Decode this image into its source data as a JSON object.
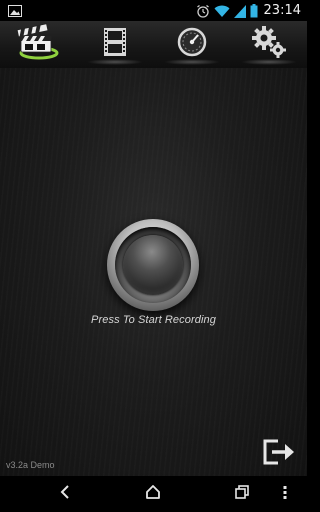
{
  "status_bar": {
    "time": "23:14",
    "icons": [
      "image-notification-icon",
      "alarm-icon",
      "wifi-icon",
      "signal-icon",
      "battery-icon"
    ]
  },
  "tabs": [
    {
      "name": "clapperboard-icon",
      "label": "",
      "selected": true
    },
    {
      "name": "film-strip-icon",
      "label": "",
      "selected": false
    },
    {
      "name": "gauge-icon",
      "label": "",
      "selected": false
    },
    {
      "name": "gears-icon",
      "label": "",
      "selected": false
    }
  ],
  "main": {
    "record_caption": "Press To Start Recording",
    "version": "v3.2a Demo",
    "exit_icon": "exit-icon"
  },
  "nav": {
    "icons": [
      "back-icon",
      "home-icon",
      "recents-icon",
      "menu-icon"
    ]
  },
  "colors": {
    "accent_green": "#8fd13f",
    "background": "#1c1c1c"
  }
}
